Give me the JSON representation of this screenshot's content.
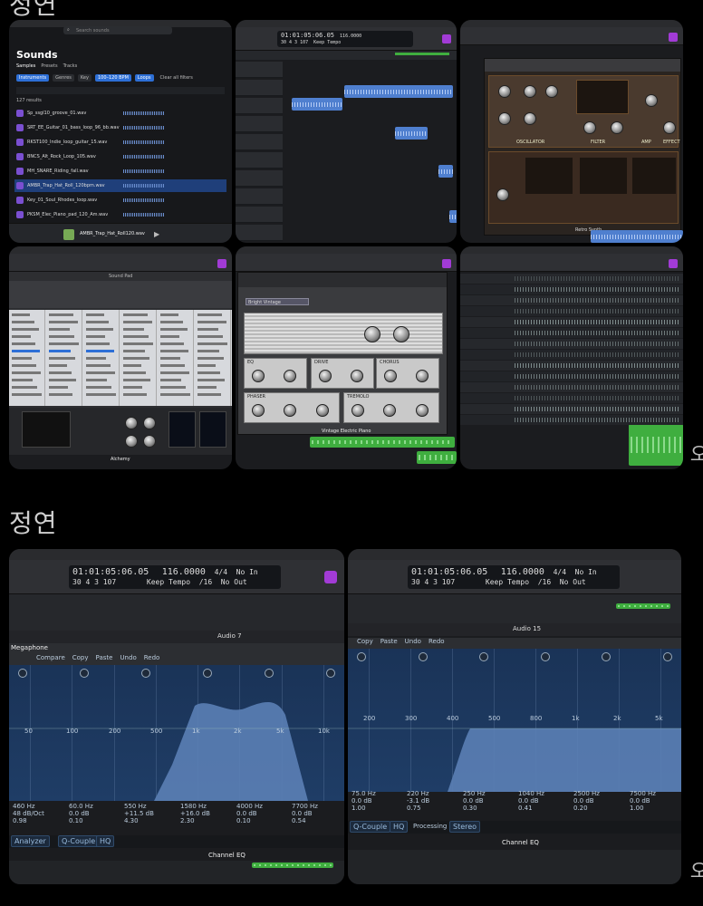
{
  "sections": {
    "top_header": "정연",
    "bottom_header": "정연",
    "edge_glyph_1": "오",
    "edge_glyph_2": "오"
  },
  "sounds": {
    "title": "Sounds",
    "search_placeholder": "Search sounds",
    "tabs": [
      "Samples",
      "Presets",
      "Tracks"
    ],
    "filters": [
      "Instruments",
      "Genres",
      "Key",
      "100–120 BPM",
      "Loops",
      "Clear all filters"
    ],
    "results_count": "127 results",
    "rows": [
      {
        "name": "Sp_ssgl10_groove_01.wav"
      },
      {
        "name": "SRT_EE_Guitar_01_bass_loop_96_bb.wav"
      },
      {
        "name": "RKST100_Indie_loop_guitar_15.wav"
      },
      {
        "name": "BNCS_Alt_Rock_Loop_105.wav"
      },
      {
        "name": "MH_SNARE_Riding_fall.wav"
      },
      {
        "name": "AMBR_Trap_Hat_Roll_120bpm.wav"
      },
      {
        "name": "Key_01_Soul_Rhodes_loop.wav"
      },
      {
        "name": "PKSM_Elec_Piano_pad_120_Am.wav"
      }
    ],
    "player_name": "AMBR_Trap_Hat_Roll120.wav"
  },
  "transport": {
    "position": "01:01:05:06.05",
    "bars": "30 4 3 107",
    "tempo": "116.0000",
    "signature": "4/4",
    "tempo_mode": "Keep Tempo",
    "division": "/16",
    "in_label": "No In",
    "out_label": "No Out"
  },
  "retro_synth": {
    "title": "Retro Synth",
    "sections": [
      "OSCILLATOR",
      "FILTER",
      "AMP",
      "EFFECT"
    ]
  },
  "alchemy": {
    "title": "Alchemy",
    "window_title": "Sound Pad"
  },
  "electric_piano": {
    "title": "Vintage Electric Piano",
    "panels": [
      "EQ",
      "DRIVE",
      "CHORUS",
      "PHASER",
      "TREMOLO"
    ],
    "bright_label": "Bright Vintage"
  },
  "channel_eq_left": {
    "track_title": "Audio 7",
    "preset": "Megaphone",
    "tabs": [
      "Compare",
      "Copy",
      "Paste",
      "Undo",
      "Redo"
    ],
    "freq_labels": [
      "50",
      "100",
      "200",
      "500",
      "1k",
      "2k",
      "5k",
      "10k"
    ],
    "bands": [
      {
        "freq": "460 Hz",
        "gain": "48 dB/Oct",
        "q": "0.98"
      },
      {
        "freq": "60.0 Hz",
        "gain": "0.0 dB",
        "q": "0.10"
      },
      {
        "freq": "550 Hz",
        "gain": "+11.5 dB",
        "q": "4.30"
      },
      {
        "freq": "1580 Hz",
        "gain": "+16.0 dB",
        "q": "2.30"
      },
      {
        "freq": "4000 Hz",
        "gain": "0.0 dB",
        "q": "0.10"
      },
      {
        "freq": "7700 Hz",
        "gain": "0.0 dB",
        "q": "0.54"
      }
    ],
    "analyzer_label": "Analyzer",
    "qcouple_label": "Q-Couple",
    "hq_label": "HQ",
    "footer": "Channel EQ"
  },
  "channel_eq_right": {
    "track_title": "Audio 15",
    "tabs": [
      "Copy",
      "Paste",
      "Undo",
      "Redo"
    ],
    "freq_labels": [
      "200",
      "300",
      "400",
      "500",
      "800",
      "1k",
      "2k",
      "5k"
    ],
    "bands": [
      {
        "freq": "75.0 Hz",
        "gain": "0.0 dB",
        "q": "1.00"
      },
      {
        "freq": "220 Hz",
        "gain": "-3.1 dB",
        "q": "0.75"
      },
      {
        "freq": "250 Hz",
        "gain": "0.0 dB",
        "q": "0.30"
      },
      {
        "freq": "1040 Hz",
        "gain": "0.0 dB",
        "q": "0.41"
      },
      {
        "freq": "2500 Hz",
        "gain": "0.0 dB",
        "q": "0.20"
      },
      {
        "freq": "7500 Hz",
        "gain": "0.0 dB",
        "q": "1.00"
      }
    ],
    "qcouple_label": "Q-Couple",
    "hq_label": "HQ",
    "processing_label": "Processing",
    "processing_value": "Stereo",
    "footer": "Channel EQ"
  },
  "colors": {
    "eq_fill": "#5b7fb5",
    "region_blue": "#4f7fcf",
    "region_green": "#3fae3f"
  }
}
